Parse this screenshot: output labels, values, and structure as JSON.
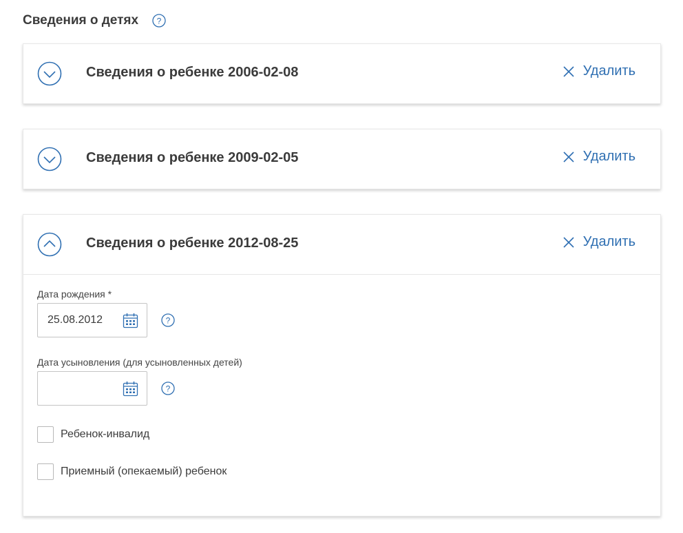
{
  "section": {
    "title": "Сведения о детях"
  },
  "children": [
    {
      "title": "Сведения о ребенке 2006-02-08",
      "delete_label": "Удалить",
      "expanded": false
    },
    {
      "title": "Сведения о ребенке 2009-02-05",
      "delete_label": "Удалить",
      "expanded": false
    },
    {
      "title": "Сведения о ребенке 2012-08-25",
      "delete_label": "Удалить",
      "expanded": true,
      "form": {
        "birth_date": {
          "label": "Дата рождения *",
          "value": "25.08.2012"
        },
        "adoption_date": {
          "label": "Дата усыновления (для усыновленных детей)",
          "value": ""
        },
        "disabled_child": {
          "label": "Ребенок-инвалид",
          "checked": false
        },
        "foster_child": {
          "label": "Приемный (опекаемый) ребенок",
          "checked": false
        }
      }
    }
  ],
  "colors": {
    "accent": "#2f6fb2",
    "title_text": "#3b3b3b",
    "border": "#c4c4c4"
  }
}
